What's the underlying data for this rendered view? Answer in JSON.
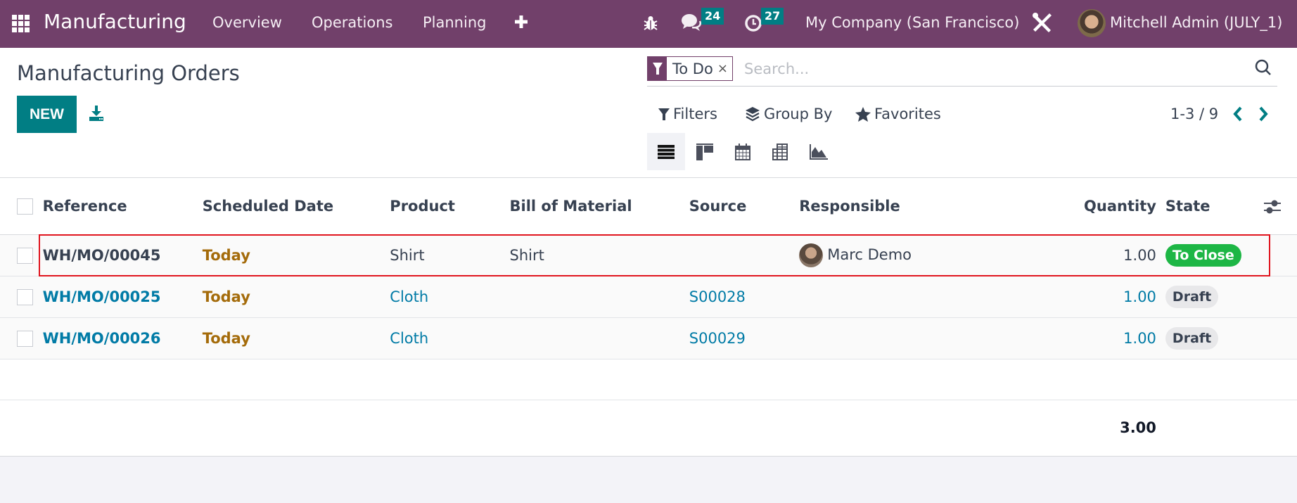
{
  "navbar": {
    "app_name": "Manufacturing",
    "menu": [
      "Overview",
      "Operations",
      "Planning"
    ],
    "messages_count": "24",
    "activities_count": "27",
    "company": "My Company (San Francisco)",
    "user": "Mitchell Admin (JULY_1)",
    "icons": [
      "apps-grid-icon",
      "plus-icon",
      "bug-icon",
      "chat-icon",
      "clock-icon",
      "tools-icon",
      "user-avatar"
    ]
  },
  "control_panel": {
    "title": "Manufacturing Orders",
    "new_label": "NEW",
    "search": {
      "facet_label": "To Do",
      "facet_close": "×",
      "placeholder": "Search..."
    },
    "filters_label": "Filters",
    "group_by_label": "Group By",
    "favorites_label": "Favorites",
    "pager": "1-3 / 9",
    "views": [
      "list",
      "kanban",
      "calendar",
      "pivot",
      "graph"
    ],
    "active_view": "list"
  },
  "table": {
    "columns": [
      "Reference",
      "Scheduled Date",
      "Product",
      "Bill of Material",
      "Source",
      "Responsible",
      "Quantity",
      "State"
    ],
    "rows": [
      {
        "reference": "WH/MO/00045",
        "scheduled_date": "Today",
        "product": "Shirt",
        "bom": "Shirt",
        "source": "",
        "responsible": "Marc Demo",
        "quantity": "1.00",
        "state": "To Close",
        "highlighted": true
      },
      {
        "reference": "WH/MO/00025",
        "scheduled_date": "Today",
        "product": "Cloth",
        "bom": "",
        "source": "S00028",
        "responsible": "",
        "quantity": "1.00",
        "state": "Draft",
        "highlighted": false
      },
      {
        "reference": "WH/MO/00026",
        "scheduled_date": "Today",
        "product": "Cloth",
        "bom": "",
        "source": "S00029",
        "responsible": "",
        "quantity": "1.00",
        "state": "Draft",
        "highlighted": false
      }
    ],
    "total_quantity": "3.00"
  },
  "colors": {
    "navbar": "#71406a",
    "primary": "#017e84",
    "link": "#017ba6",
    "date_warning": "#a46b0a",
    "state_to_close": "#1db645",
    "highlight_border": "#e0141e"
  }
}
